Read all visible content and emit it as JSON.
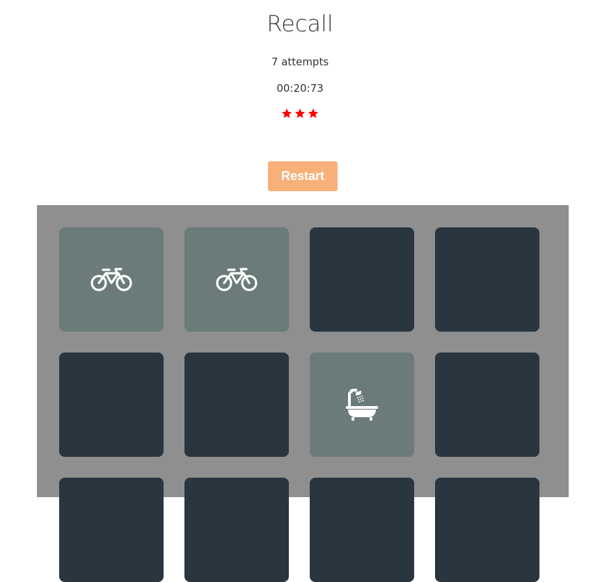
{
  "game": {
    "title": "Recall",
    "attempts": "7 attempts",
    "timer": "00:20:73",
    "star_rating": 3,
    "restart_label": "Restart"
  },
  "colors": {
    "star": "#ff0000",
    "restart_button": "#f7b07a",
    "board_background": "#8f8f8f",
    "card_hidden": "#29353f",
    "card_revealed": "#6b7b7a"
  },
  "cards": [
    {
      "state": "revealed",
      "icon": "bicycle-icon"
    },
    {
      "state": "revealed",
      "icon": "bicycle-icon"
    },
    {
      "state": "hidden",
      "icon": ""
    },
    {
      "state": "hidden",
      "icon": ""
    },
    {
      "state": "hidden",
      "icon": ""
    },
    {
      "state": "hidden",
      "icon": ""
    },
    {
      "state": "revealed",
      "icon": "bathtub-icon"
    },
    {
      "state": "hidden",
      "icon": ""
    },
    {
      "state": "hidden",
      "icon": ""
    },
    {
      "state": "hidden",
      "icon": ""
    },
    {
      "state": "hidden",
      "icon": ""
    },
    {
      "state": "hidden",
      "icon": ""
    }
  ]
}
